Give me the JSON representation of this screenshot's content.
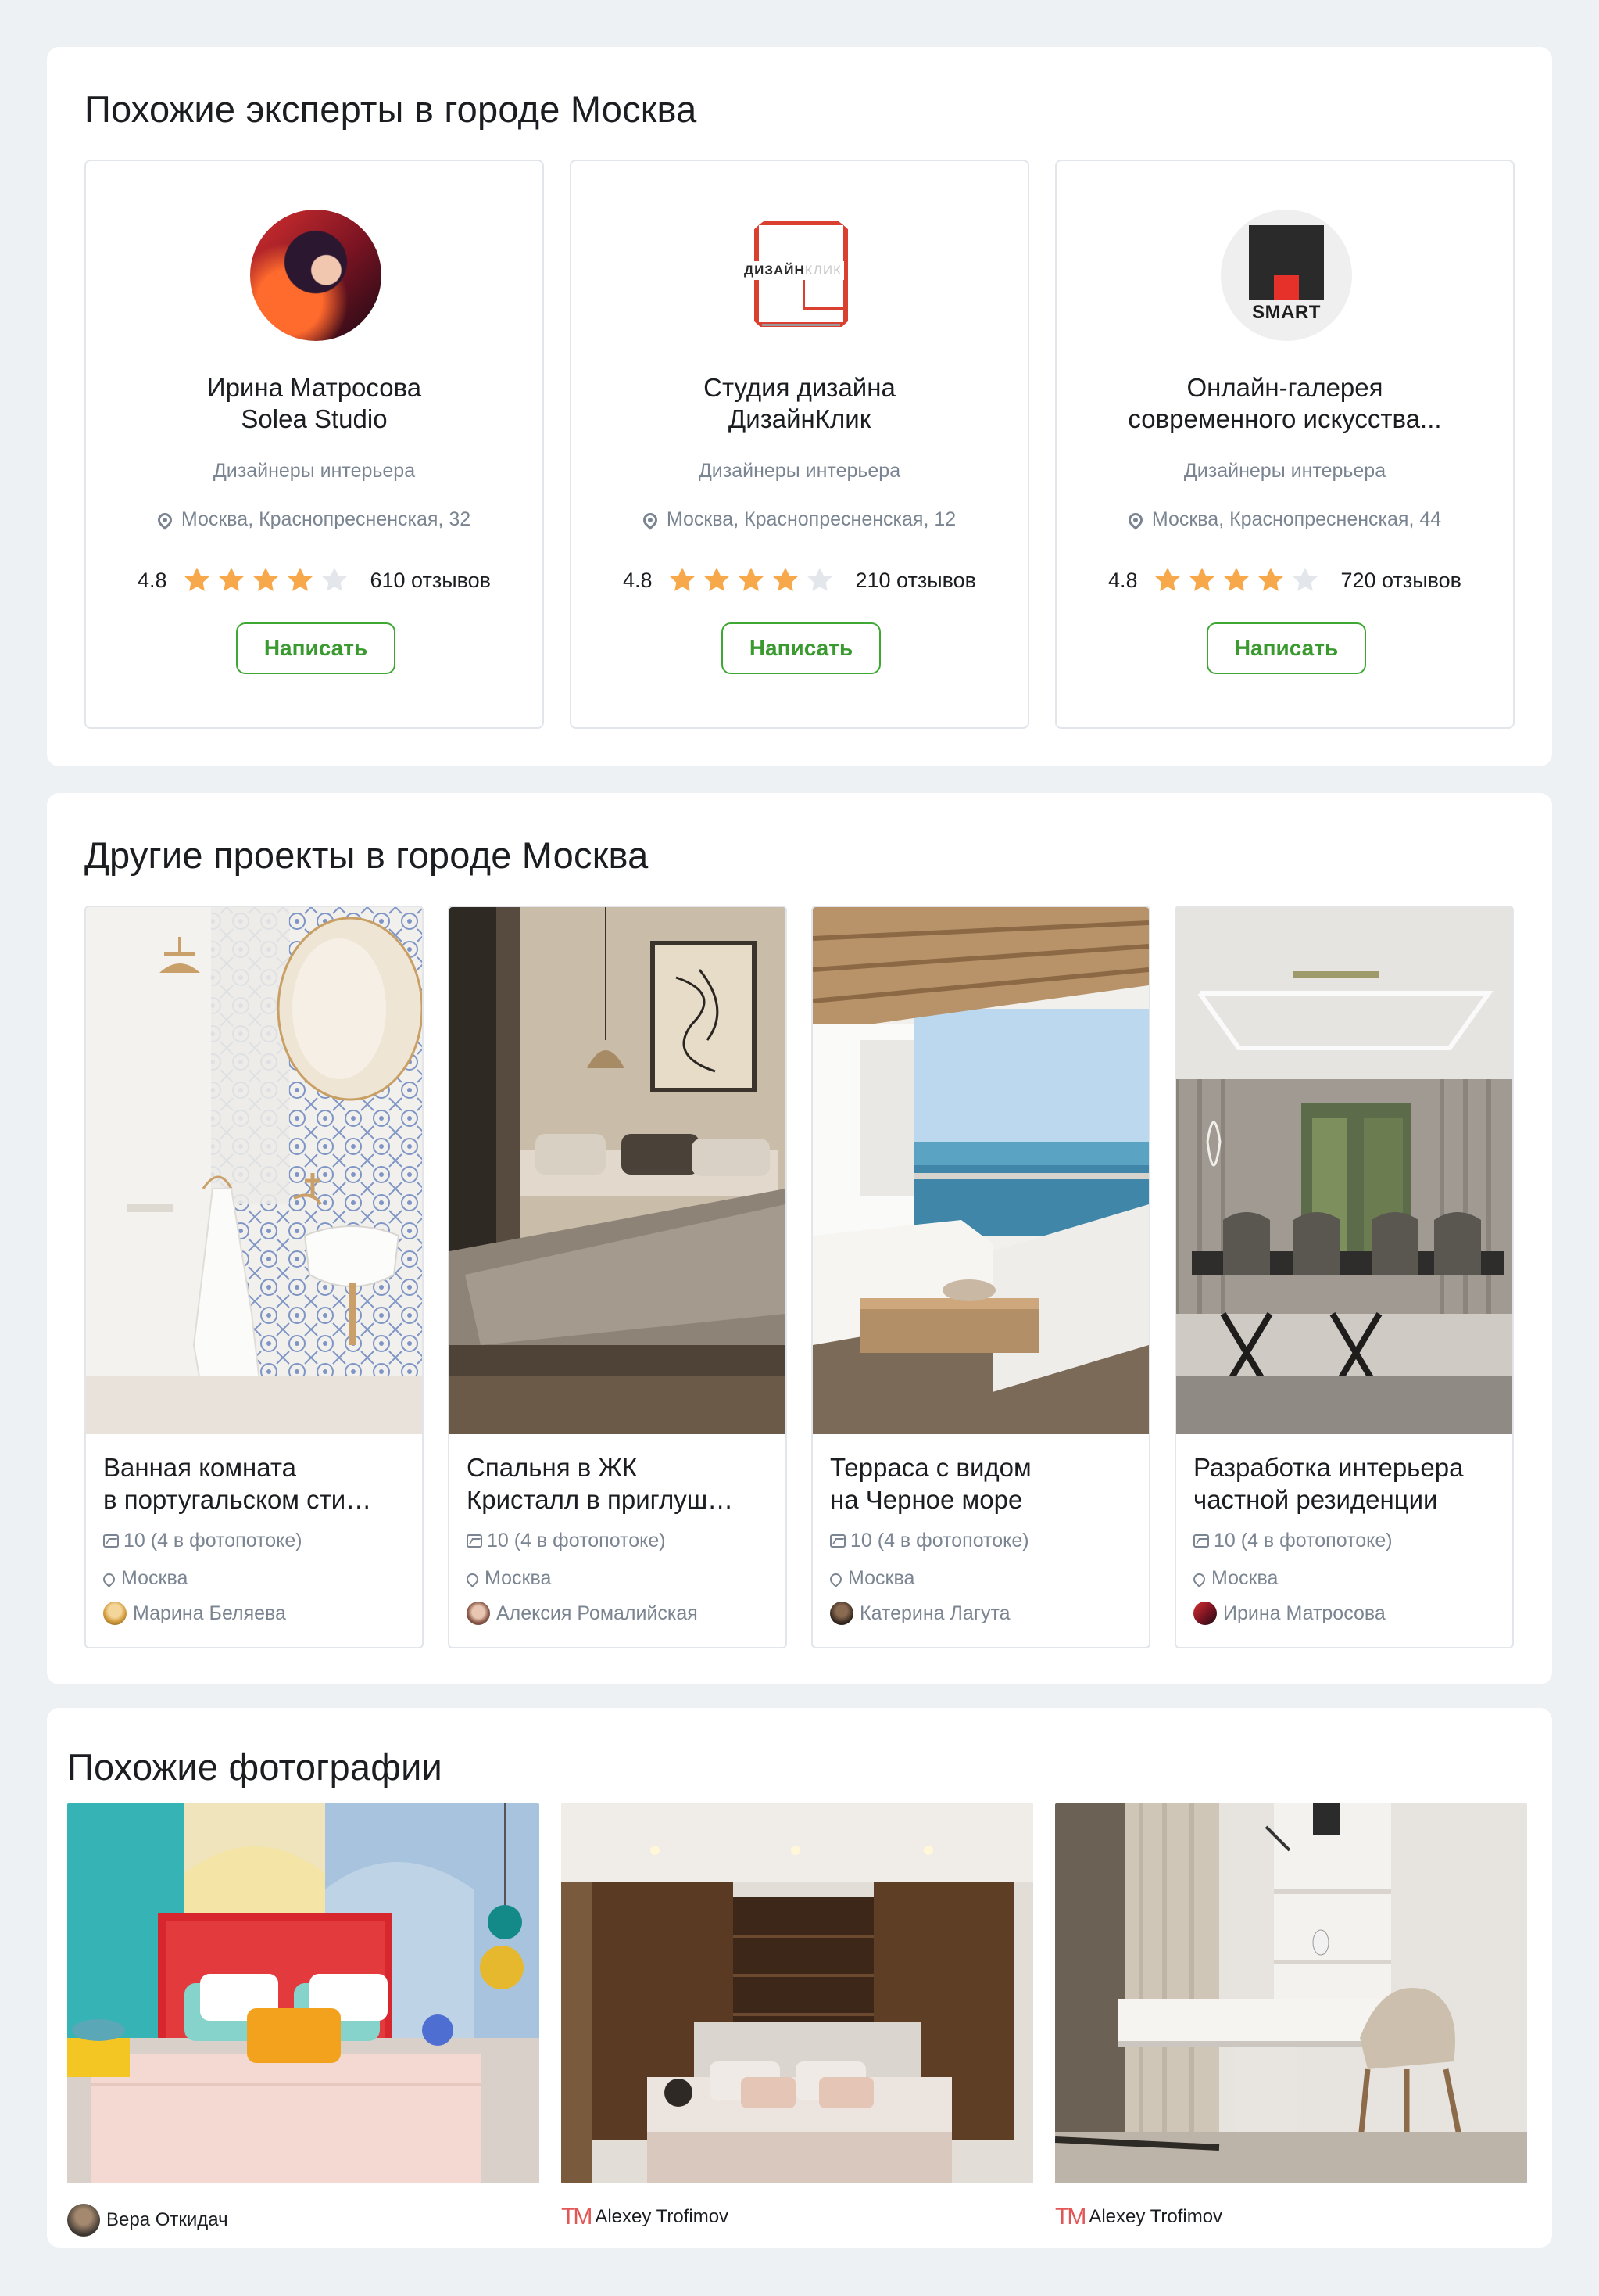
{
  "experts_section": {
    "title": "Похожие эксперты в городе Москва",
    "experts": [
      {
        "name_line1": "Ирина Матросова",
        "name_line2": "Solea Studio",
        "category": "Дизайнеры интерьера",
        "address": "Москва, Краснопресненская, 32",
        "rating": "4.8",
        "stars_filled": 4,
        "reviews": "610 отзывов",
        "button": "Написать"
      },
      {
        "name_line1": "Студия дизайна",
        "name_line2": "ДизайнКлик",
        "category": "Дизайнеры интерьера",
        "address": "Москва, Краснопресненская, 12",
        "rating": "4.8",
        "stars_filled": 4,
        "reviews": "210 отзывов",
        "button": "Написать",
        "logo_text_bold": "ДИЗАЙН",
        "logo_text_light": "КЛИК"
      },
      {
        "name_line1": "Онлайн-галерея",
        "name_line2": "современного искусства...",
        "category": "Дизайнеры интерьера",
        "address": "Москва, Краснопресненская, 44",
        "rating": "4.8",
        "stars_filled": 4,
        "reviews": "720 отзывов",
        "button": "Написать",
        "logo_text": "SMART"
      }
    ]
  },
  "projects_section": {
    "title": "Другие проекты в городе Москва",
    "projects": [
      {
        "title_line1": "Ванная комната",
        "title_line2": "в португальском сти…",
        "photos": "10 (4 в фотопотоке)",
        "city": "Москва",
        "author": "Марина Беляева"
      },
      {
        "title_line1": "Спальня в ЖК",
        "title_line2": "Кристалл в приглуш…",
        "photos": "10 (4 в фотопотоке)",
        "city": "Москва",
        "author": "Алексия Ромалийская"
      },
      {
        "title_line1": "Терраса с видом",
        "title_line2": "на Черное море",
        "photos": "10 (4 в фотопотоке)",
        "city": "Москва",
        "author": "Катерина Лагута"
      },
      {
        "title_line1": "Разработка интерьера",
        "title_line2": "частной резиденции",
        "photos": "10 (4 в фотопотоке)",
        "city": "Москва",
        "author": "Ирина Матросова"
      }
    ]
  },
  "photos_section": {
    "title": "Похожие фотографии",
    "photos": [
      {
        "author": "Вера Откидач"
      },
      {
        "author": "Alexey Trofimov",
        "logo": "TM"
      },
      {
        "author": "Alexey Trofimov",
        "logo": "TM"
      }
    ]
  },
  "colors": {
    "accent_green": "#3fa835",
    "star_filled": "#f7a84a",
    "star_empty": "#e3e7ec",
    "muted_text": "#7b8591",
    "page_bg": "#eef1f4"
  }
}
